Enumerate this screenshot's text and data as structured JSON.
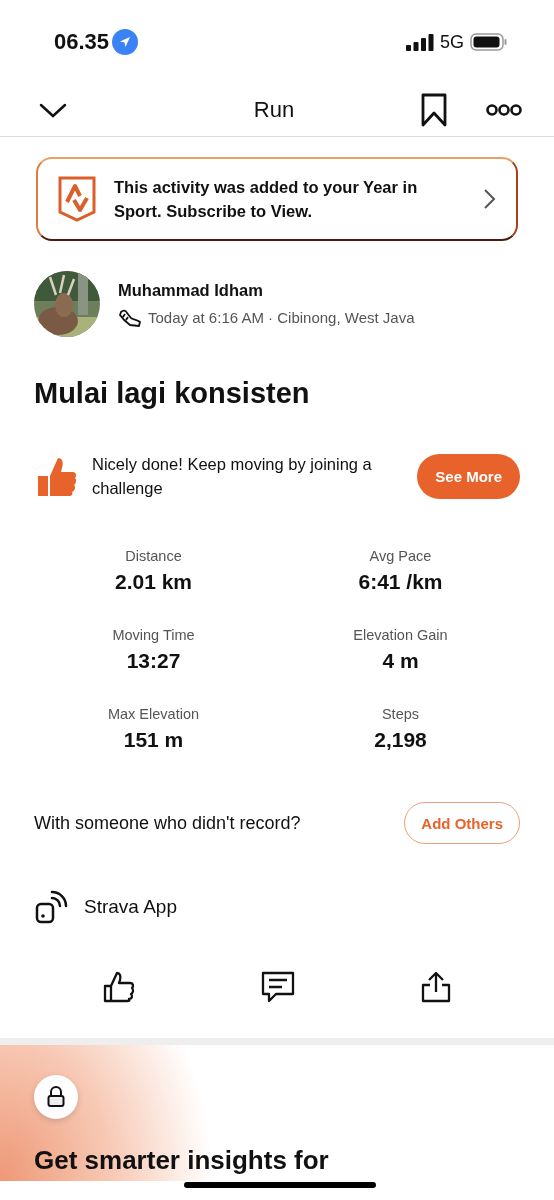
{
  "status_bar": {
    "time": "06.35",
    "network": "5G"
  },
  "nav": {
    "title": "Run"
  },
  "banner": {
    "text": "This activity was added to your Year in Sport. Subscribe to View."
  },
  "athlete": {
    "name": "Muhammad Idham",
    "meta": "Today at 6:16 AM · Cibinong, West Java"
  },
  "activity_title": "Mulai lagi konsisten",
  "challenge": {
    "text": "Nicely done! Keep moving by joining a challenge",
    "button": "See More"
  },
  "stats": [
    {
      "label": "Distance",
      "value": "2.01 km"
    },
    {
      "label": "Avg Pace",
      "value": "6:41 /km"
    },
    {
      "label": "Moving Time",
      "value": "13:27"
    },
    {
      "label": "Elevation Gain",
      "value": "4 m"
    },
    {
      "label": "Max Elevation",
      "value": "151 m"
    },
    {
      "label": "Steps",
      "value": "2,198"
    }
  ],
  "with_others": {
    "text": "With someone who didn't record?",
    "button": "Add Others"
  },
  "device": "Strava App",
  "upsell": {
    "title": "Get smarter insights for"
  }
}
